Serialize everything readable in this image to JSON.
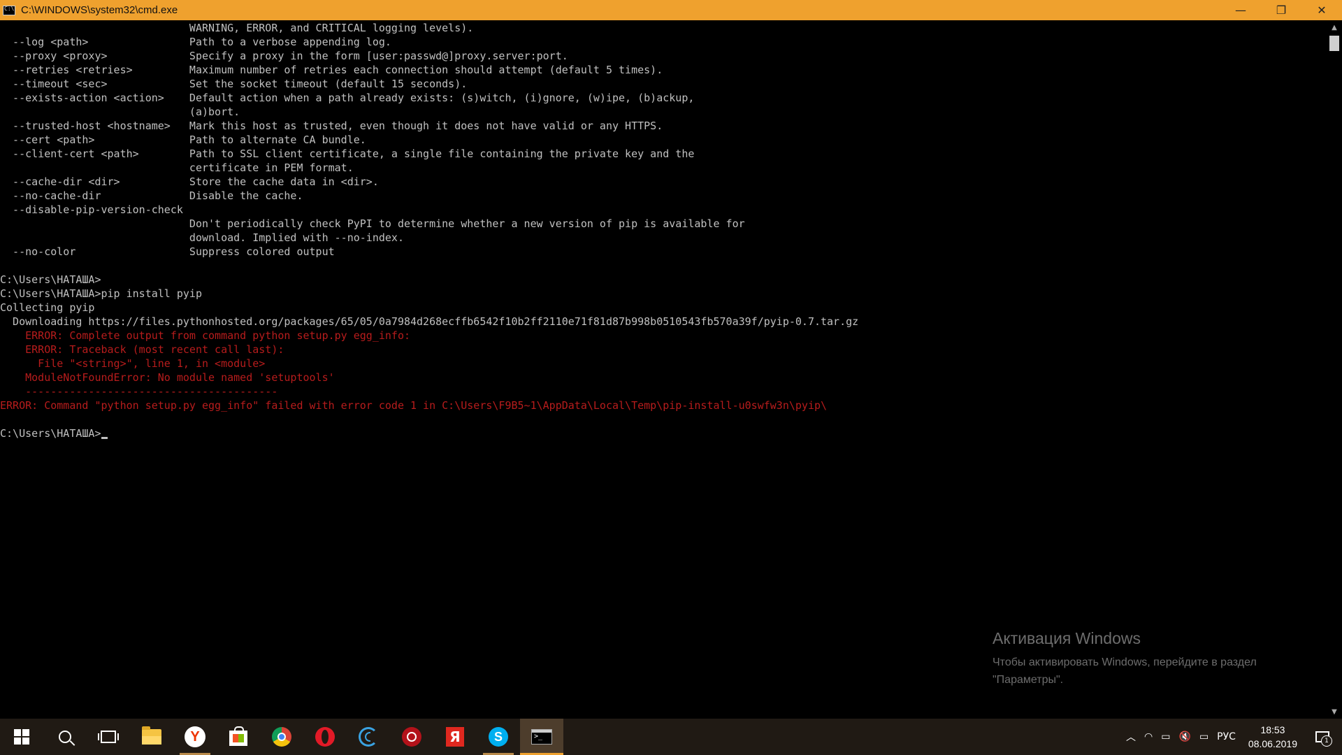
{
  "window": {
    "title": "C:\\WINDOWS\\system32\\cmd.exe",
    "buttons": {
      "minimize": "—",
      "restore": "❐",
      "close": "✕"
    }
  },
  "console": {
    "lines": [
      {
        "text": "                              WARNING, ERROR, and CRITICAL logging levels).",
        "type": "normal"
      },
      {
        "text": "  --log <path>                Path to a verbose appending log.",
        "type": "normal"
      },
      {
        "text": "  --proxy <proxy>             Specify a proxy in the form [user:passwd@]proxy.server:port.",
        "type": "normal"
      },
      {
        "text": "  --retries <retries>         Maximum number of retries each connection should attempt (default 5 times).",
        "type": "normal"
      },
      {
        "text": "  --timeout <sec>             Set the socket timeout (default 15 seconds).",
        "type": "normal"
      },
      {
        "text": "  --exists-action <action>    Default action when a path already exists: (s)witch, (i)gnore, (w)ipe, (b)ackup,",
        "type": "normal"
      },
      {
        "text": "                              (a)bort.",
        "type": "normal"
      },
      {
        "text": "  --trusted-host <hostname>   Mark this host as trusted, even though it does not have valid or any HTTPS.",
        "type": "normal"
      },
      {
        "text": "  --cert <path>               Path to alternate CA bundle.",
        "type": "normal"
      },
      {
        "text": "  --client-cert <path>        Path to SSL client certificate, a single file containing the private key and the",
        "type": "normal"
      },
      {
        "text": "                              certificate in PEM format.",
        "type": "normal"
      },
      {
        "text": "  --cache-dir <dir>           Store the cache data in <dir>.",
        "type": "normal"
      },
      {
        "text": "  --no-cache-dir              Disable the cache.",
        "type": "normal"
      },
      {
        "text": "  --disable-pip-version-check",
        "type": "normal"
      },
      {
        "text": "                              Don't periodically check PyPI to determine whether a new version of pip is available for",
        "type": "normal"
      },
      {
        "text": "                              download. Implied with --no-index.",
        "type": "normal"
      },
      {
        "text": "  --no-color                  Suppress colored output",
        "type": "normal"
      },
      {
        "text": "",
        "type": "normal"
      },
      {
        "text": "C:\\Users\\НАТАША>",
        "type": "normal"
      },
      {
        "text": "C:\\Users\\НАТАША>pip install pyip",
        "type": "normal"
      },
      {
        "text": "Collecting pyip",
        "type": "normal"
      },
      {
        "text": "  Downloading https://files.pythonhosted.org/packages/65/05/0a7984d268ecffb6542f10b2ff2110e71f81d87b998b0510543fb570a39f/pyip-0.7.tar.gz",
        "type": "normal"
      },
      {
        "text": "    ERROR: Complete output from command python setup.py egg_info:",
        "type": "error"
      },
      {
        "text": "    ERROR: Traceback (most recent call last):",
        "type": "error"
      },
      {
        "text": "      File \"<string>\", line 1, in <module>",
        "type": "error"
      },
      {
        "text": "    ModuleNotFoundError: No module named 'setuptools'",
        "type": "error"
      },
      {
        "text": "    ----------------------------------------",
        "type": "error"
      },
      {
        "text": "ERROR: Command \"python setup.py egg_info\" failed with error code 1 in C:\\Users\\F9B5~1\\AppData\\Local\\Temp\\pip-install-u0swfw3n\\pyip\\",
        "type": "error"
      },
      {
        "text": "",
        "type": "normal"
      }
    ],
    "prompt": "C:\\Users\\НАТАША>"
  },
  "scrollbar": {
    "up_arrow": "▲",
    "down_arrow": "▼"
  },
  "activation": {
    "title": "Активация Windows",
    "text": "Чтобы активировать Windows, перейдите в раздел \"Параметры\"."
  },
  "taskbar": {
    "pinned": [
      {
        "name": "start",
        "icon": "windows-start-icon"
      },
      {
        "name": "search",
        "icon": "search-icon"
      },
      {
        "name": "task-view",
        "icon": "task-view-icon"
      },
      {
        "name": "file-explorer",
        "icon": "folder-icon"
      },
      {
        "name": "yandex-browser",
        "icon": "yandex-browser-icon",
        "glyph": "Y"
      },
      {
        "name": "store",
        "icon": "store-icon"
      },
      {
        "name": "chrome",
        "icon": "chrome-icon"
      },
      {
        "name": "opera",
        "icon": "opera-icon"
      },
      {
        "name": "ccleaner",
        "icon": "ccleaner-icon"
      },
      {
        "name": "mcafee",
        "icon": "mcafee-icon"
      },
      {
        "name": "yandex",
        "icon": "yandex-icon",
        "glyph": "Я"
      },
      {
        "name": "skype",
        "icon": "skype-icon",
        "glyph": "S"
      },
      {
        "name": "cmd",
        "icon": "cmd-icon"
      }
    ],
    "tray": {
      "chevron": "︿",
      "wifi": "◠",
      "network": "▭",
      "volume": "🔇",
      "battery": "▭",
      "language": "РУС",
      "time": "18:53",
      "date": "08.06.2019",
      "notification_count": "1"
    }
  },
  "colors": {
    "titlebar": "#efa12e",
    "console_bg": "#000000",
    "console_text": "#c0c0c0",
    "error_text": "#b71c1c",
    "taskbar": "#201a14"
  }
}
